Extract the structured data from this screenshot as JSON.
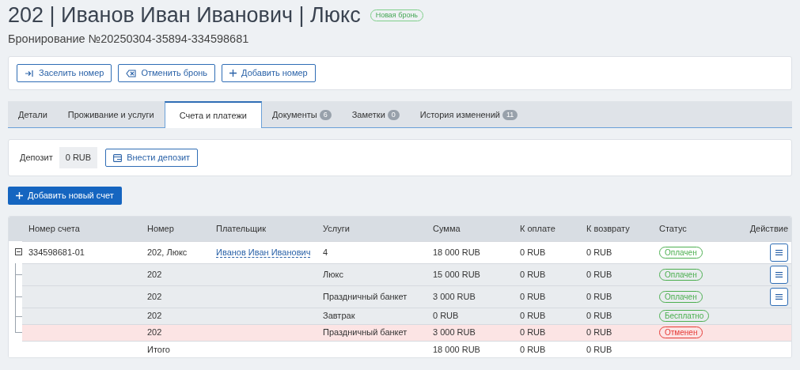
{
  "header": {
    "title": "202 | Иванов Иван Иванович | Люкс",
    "badge": "Новая бронь",
    "subtitle": "Бронирование №20250304-35894-334598681"
  },
  "actions": [
    {
      "kind": "checkin",
      "label": "Заселить номер"
    },
    {
      "kind": "cancel",
      "label": "Отменить бронь"
    },
    {
      "kind": "add",
      "label": "Добавить номер"
    }
  ],
  "tabs": [
    {
      "label": "Детали",
      "selected": false
    },
    {
      "label": "Проживание и услуги",
      "selected": false
    },
    {
      "label": "Счета и платежи",
      "selected": true
    },
    {
      "label": "Документы",
      "count": "6",
      "selected": false
    },
    {
      "label": "Заметки",
      "count": "0",
      "selected": false
    },
    {
      "label": "История изменений",
      "count": "11",
      "selected": false
    }
  ],
  "deposit": {
    "label": "Депозит",
    "value": "0 RUB",
    "button": "Внести депозит"
  },
  "add_invoice_button": "Добавить новый счет",
  "table": {
    "columns": [
      "Номер счета",
      "Номер",
      "Плательщик",
      "Услуги",
      "Сумма",
      "К оплате",
      "К возврату",
      "Статус",
      "Действие"
    ],
    "rows": [
      {
        "kind": "invoice",
        "expanded": true,
        "invoice": "334598681-01",
        "room": "202, Люкс",
        "payer": "Иванов Иван Иванович",
        "services": "4",
        "sum": "18 000 RUB",
        "due": "0 RUB",
        "refund": "0 RUB",
        "status": "Оплачен",
        "color": "#4caf50",
        "menu": true
      },
      {
        "kind": "item",
        "cancelled": false,
        "room": "202",
        "services": "Люкс",
        "sum": "15 000 RUB",
        "due": "0 RUB",
        "refund": "0 RUB",
        "status": "Оплачен",
        "color": "#4caf50",
        "menu": true
      },
      {
        "kind": "item",
        "cancelled": false,
        "room": "202",
        "services": "Праздничный банкет",
        "sum": "3 000 RUB",
        "due": "0 RUB",
        "refund": "0 RUB",
        "status": "Оплачен",
        "color": "#4caf50",
        "menu": true
      },
      {
        "kind": "item",
        "cancelled": false,
        "room": "202",
        "services": "Завтрак",
        "sum": "0 RUB",
        "due": "0 RUB",
        "refund": "0 RUB",
        "status": "Бесплатно",
        "color": "#4caf50",
        "menu": false
      },
      {
        "kind": "item",
        "cancelled": true,
        "room": "202",
        "services": "Праздничный банкет",
        "sum": "3 000 RUB",
        "due": "0 RUB",
        "refund": "0 RUB",
        "status": "Отменен",
        "color": "#e53935",
        "menu": false
      },
      {
        "kind": "total",
        "room": "Итого",
        "sum": "18 000 RUB",
        "due": "0 RUB",
        "refund": "0 RUB"
      }
    ]
  }
}
